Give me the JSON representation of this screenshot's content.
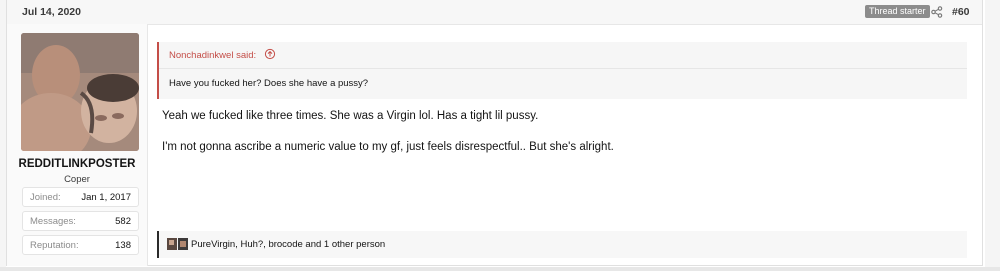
{
  "post": {
    "date": "Jul 14, 2020",
    "badge": "Thread starter",
    "number": "#60"
  },
  "user": {
    "name": "REDDITLINKPOSTER",
    "title": "Coper",
    "stats": [
      {
        "label": "Joined:",
        "value": "Jan 1, 2017"
      },
      {
        "label": "Messages:",
        "value": "582"
      },
      {
        "label": "Reputation:",
        "value": "138"
      }
    ]
  },
  "quote": {
    "author": "Nonchadinkwel said:",
    "text": "Have you fucked her? Does she have a pussy?"
  },
  "message": {
    "line1": "Yeah we fucked like three times. She was a Virgin lol. Has a tight lil pussy.",
    "line2": "I'm not gonna ascribe a numeric value to my gf, just feels disrespectful.. But she's alright."
  },
  "reactions": {
    "text": "PureVirgin, Huh?, brocode and 1 other person"
  },
  "icons": {
    "share": "share-icon",
    "quote_link": "arrow-up-circle-icon"
  },
  "colors": {
    "quote_accent": "#c44e48",
    "badge_bg": "#8c8c8c"
  }
}
